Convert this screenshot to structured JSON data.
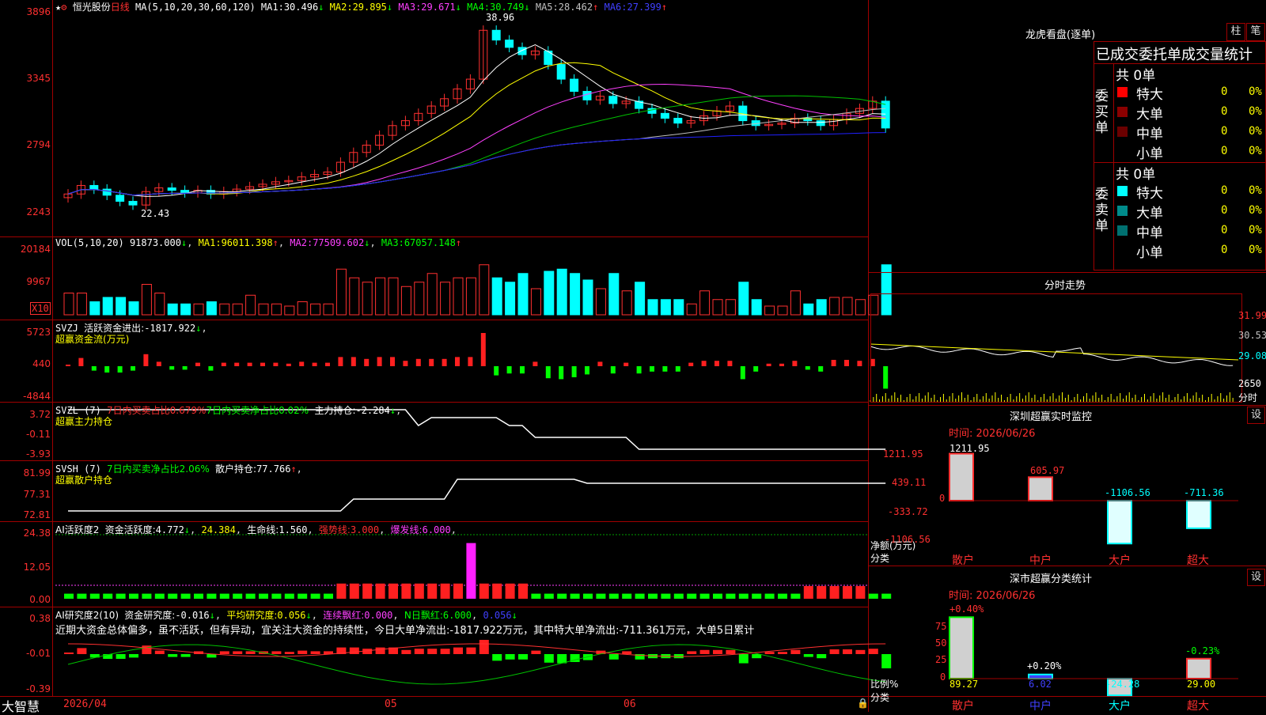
{
  "app": {
    "name": "大智慧",
    "stock": "恒光股份",
    "period": "日线"
  },
  "colors": {
    "up": "#ff3030",
    "down": "#00ffff",
    "ma1": "#ffffff",
    "ma2": "#ffff00",
    "ma3": "#ff40ff",
    "ma4": "#00c000",
    "ma5": "#c0c0c0",
    "ma6": "#2020ff"
  },
  "main": {
    "ma_header": "MA(5,10,20,30,60,120)",
    "ma": [
      {
        "label": "MA1:",
        "value": "30.496",
        "arrow": "↓"
      },
      {
        "label": "MA2:",
        "value": "29.895",
        "arrow": "↓"
      },
      {
        "label": "MA3:",
        "value": "29.671",
        "arrow": "↓"
      },
      {
        "label": "MA4:",
        "value": "30.749",
        "arrow": "↓"
      },
      {
        "label": "MA5:",
        "value": "28.462",
        "arrow": "↑"
      },
      {
        "label": "MA6:",
        "value": "27.399",
        "arrow": "↑"
      }
    ],
    "yticks": [
      "3896",
      "3345",
      "2794",
      "2243"
    ],
    "high_mark": "38.96",
    "low_mark": "22.43"
  },
  "vol": {
    "header": "VOL(5,10,20)",
    "value": "91873.000",
    "arrow": "↓",
    "ma": [
      {
        "label": "MA1:",
        "value": "96011.398",
        "arrow": "↑"
      },
      {
        "label": "MA2:",
        "value": "77509.602",
        "arrow": "↓"
      },
      {
        "label": "MA3:",
        "value": "67057.148",
        "arrow": "↑"
      }
    ],
    "yticks": [
      "20184",
      "9967"
    ],
    "unit": "X10"
  },
  "svzj": {
    "header": "SVZJ",
    "label": "活跃资金进出:",
    "value": "-1817.922",
    "arrow": "↓",
    "sub": "超赢资金流(万元)",
    "yticks": [
      "5723",
      "440",
      "-4844"
    ]
  },
  "svzl": {
    "header": "SVZL (7)",
    "t1": "7日内买卖占比0.679%",
    "t2": "7日内买卖净占比0.02%",
    "t3": "主力持仓:",
    "value": "-2.284",
    "arrow": "↓",
    "sub": "超赢主力持仓",
    "yticks": [
      "3.72",
      "-0.11",
      "-3.93"
    ]
  },
  "svsh": {
    "header": "SVSH (7)",
    "t1": "7日内买卖净占比2.06%",
    "t2": "散户持仓:",
    "value": "77.766",
    "arrow": "↑",
    "sub": "超赢散户持仓",
    "yticks": [
      "81.99",
      "77.31",
      "72.81"
    ]
  },
  "ai1": {
    "header": "AI活跃度2",
    "t1": "资金活跃度:",
    "v1": "4.772",
    "a1": "↓",
    "v2": "24.384",
    "t3": "生命线:",
    "v3": "1.560",
    "t4": "强势线:",
    "v4": "3.000",
    "t5": "爆发线:",
    "v5": "6.000",
    "yticks": [
      "24.38",
      "12.05",
      "0.00"
    ]
  },
  "ai2": {
    "header": "AI研究度2(10)",
    "t1": "资金研究度:",
    "v1": "-0.016",
    "a1": "↓",
    "t2": "平均研究度:",
    "v2": "0.056",
    "a2": "↓",
    "t3": "连续飘红:",
    "v3": "0.000",
    "t4": "N日飘红:",
    "v4": "6.000",
    "v5": "0.056",
    "a5": "↓",
    "text": "近期大资金总体偏多，虽不活跃，但有异动，宜关注大资金的持续性，今日大单净流出:-1817.922万元，其中特大单净流出:-711.361万元，大单5日累计",
    "yticks": [
      "0.38",
      "-0.01",
      "-0.39"
    ]
  },
  "xaxis": [
    "2026/04",
    "05",
    "06"
  ],
  "dragon": {
    "title": "龙虎看盘(逐单)",
    "btn1": "柱",
    "btn2": "笔",
    "subtitle": "已成交委托单成交量统计",
    "buy": {
      "side": "委买单",
      "total": "共 0单",
      "rows": [
        {
          "name": "特大",
          "n": "0",
          "p": "0%"
        },
        {
          "name": "大单",
          "n": "0",
          "p": "0%"
        },
        {
          "name": "中单",
          "n": "0",
          "p": "0%"
        },
        {
          "name": "小单",
          "n": "0",
          "p": "0%"
        }
      ]
    },
    "sell": {
      "side": "委卖单",
      "total": "共 0单",
      "rows": [
        {
          "name": "特大",
          "n": "0",
          "p": "0%"
        },
        {
          "name": "大单",
          "n": "0",
          "p": "0%"
        },
        {
          "name": "中单",
          "n": "0",
          "p": "0%"
        },
        {
          "name": "小单",
          "n": "0",
          "p": "0%"
        }
      ]
    }
  },
  "intraday": {
    "title": "分时走势",
    "yticks": [
      "31.99",
      "30.53",
      "29.08"
    ],
    "vol_tick": "2650",
    "unit": "分时"
  },
  "monitor": {
    "title": "深圳超赢实时监控",
    "btn": "设",
    "date": "时间: 2026/06/26",
    "yticks": [
      "1211.95",
      "439.11",
      "0",
      "-333.72",
      "-1106.56"
    ],
    "ylabel": "净额(万元)",
    "xlabel": "分类",
    "categories": [
      "散户",
      "中户",
      "大户",
      "超大"
    ],
    "values": [
      1211.95,
      605.97,
      -1106.56,
      -711.36
    ],
    "labels": [
      "1211.95",
      "605.97",
      "-1106.56",
      "-711.36"
    ]
  },
  "classify": {
    "title": "深市超赢分类统计",
    "btn": "设",
    "date": "时间: 2026/06/26",
    "yticks": [
      "75",
      "50",
      "25",
      "0"
    ],
    "ylabel": "比例%",
    "xlabel": "分类",
    "categories": [
      "散户",
      "中户",
      "大户",
      "超大"
    ],
    "values": [
      89.27,
      6.02,
      -24.28,
      29.0
    ],
    "labels": [
      "89.27",
      "6.02",
      "-24.28",
      "29.00"
    ],
    "top_labels": [
      "+0.40%",
      "+0.20%",
      "",
      "-0.23%"
    ]
  },
  "chart_data": {
    "type": "candlestick",
    "title": "恒光股份 日线",
    "x_labels": [
      "2026/04",
      "05",
      "06"
    ],
    "y_range": [
      22.43,
      38.96
    ],
    "close_last": 27.4,
    "high": 38.96,
    "low": 22.43
  }
}
